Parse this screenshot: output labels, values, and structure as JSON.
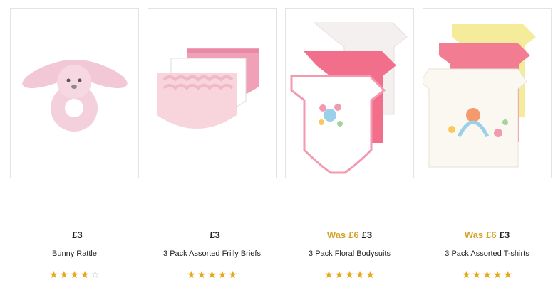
{
  "products": [
    {
      "price_now": "£3",
      "was_label": "",
      "price_was": "",
      "name": "Bunny Rattle",
      "rating": 4,
      "rating_max": 5,
      "image_icon": "bunny-rattle-image"
    },
    {
      "price_now": "£3",
      "was_label": "",
      "price_was": "",
      "name": "3 Pack Assorted Frilly Briefs",
      "rating": 5,
      "rating_max": 5,
      "image_icon": "frilly-briefs-image"
    },
    {
      "price_now": "£3",
      "was_label": "Was",
      "price_was": "£6",
      "name": "3 Pack Floral Bodysuits",
      "rating": 5,
      "rating_max": 5,
      "image_icon": "floral-bodysuits-image"
    },
    {
      "price_now": "£3",
      "was_label": "Was",
      "price_was": "£6",
      "name": "3 Pack Assorted T-shirts",
      "rating": 5,
      "rating_max": 5,
      "image_icon": "assorted-tshirts-image"
    }
  ],
  "colors": {
    "was_price": "#d4a12b",
    "star_full": "#e6a817",
    "star_empty": "#c9c9c9",
    "border": "#e3e3e3"
  }
}
